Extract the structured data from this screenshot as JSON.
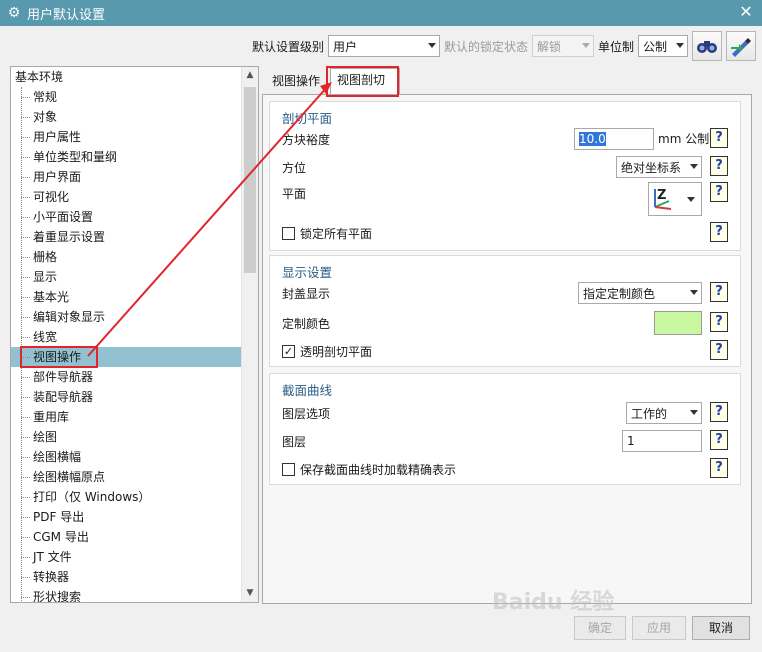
{
  "window": {
    "title": "用户默认设置",
    "close_glyph": "✕"
  },
  "toolbar": {
    "level_label": "默认设置级别",
    "level_value": "用户",
    "lock_label": "默认的锁定状态",
    "lock_value": "解锁",
    "unit_label": "单位制",
    "unit_value": "公制",
    "icons": [
      "binoculars-icon",
      "pen-arrow-icon"
    ]
  },
  "tree": {
    "root": "基本环境",
    "items": [
      "常规",
      "对象",
      "用户属性",
      "单位类型和量纲",
      "用户界面",
      "可视化",
      "小平面设置",
      "着重显示设置",
      "栅格",
      "显示",
      "基本光",
      "编辑对象显示",
      "线宽",
      "视图操作",
      "部件导航器",
      "装配导航器",
      "重用库",
      "绘图",
      "绘图横幅",
      "绘图横幅原点",
      "打印（仅 Windows）",
      "PDF 导出",
      "CGM 导出",
      "JT 文件",
      "转换器",
      "形状搜索"
    ],
    "selected": "视图操作"
  },
  "tabs": {
    "view_ops": "视图操作",
    "view_section": "视图剖切"
  },
  "section_plane": {
    "title": "剖切平面",
    "cube_size_label": "方块裕度",
    "cube_size_value": "10.0",
    "cube_size_unit": "mm 公制",
    "orientation_label": "方位",
    "orientation_value": "绝对坐标系",
    "plane_label": "平面",
    "plane_glyph": "Z",
    "lock_all_label": "锁定所有平面"
  },
  "display": {
    "title": "显示设置",
    "cap_label": "封盖显示",
    "cap_value": "指定定制颜色",
    "custom_color_label": "定制颜色",
    "custom_color": "#c8f9a0",
    "transparent_label": "透明剖切平面",
    "transparent_checked": "✓"
  },
  "curves": {
    "title": "截面曲线",
    "layer_option_label": "图层选项",
    "layer_option_value": "工作的",
    "layer_label": "图层",
    "layer_value": "1",
    "save_label": "保存截面曲线时加载精确表示"
  },
  "help_glyph": "?",
  "buttons": {
    "ok": "确定",
    "apply": "应用",
    "cancel": "取消"
  },
  "watermark": "Baidu 经验",
  "colors": {
    "titlebar": "#5899ad",
    "selection": "#92c2d2",
    "annotation": "#e0262a",
    "group_title": "#2a5e88"
  }
}
